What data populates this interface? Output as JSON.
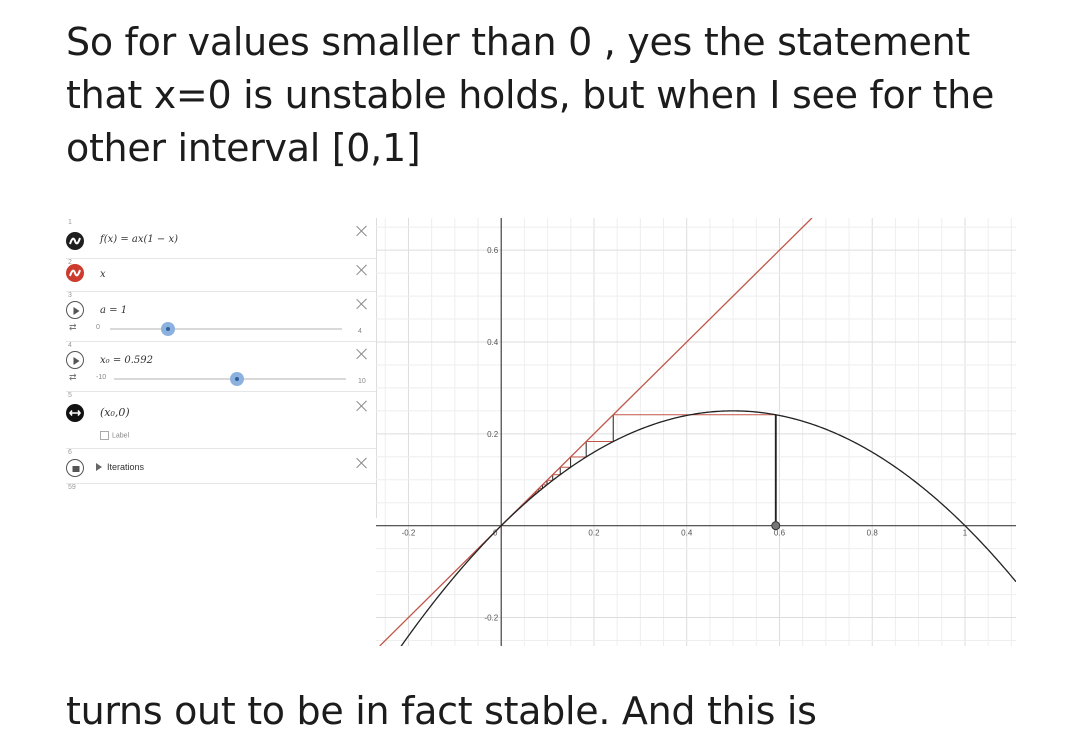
{
  "text": {
    "top": "So for values smaller than 0 , yes the statement that x=0 is unstable holds, but when I see for the other interval [0,1]",
    "bottom": "turns out to be in fact stable. And this is"
  },
  "algebra": {
    "rows": [
      {
        "num": "1",
        "expr": "f(x) = ax(1 − x)"
      },
      {
        "num": "2",
        "expr": "x"
      },
      {
        "num": "3",
        "expr": "a = 1",
        "slider": {
          "min": "0",
          "max": "4",
          "value": 1
        }
      },
      {
        "num": "4",
        "expr": "x₀ = 0.592",
        "slider": {
          "min": "-10",
          "max": "10",
          "value": 0.592
        }
      },
      {
        "num": "5",
        "expr": "(x₀,0)",
        "label_checkbox": "Label"
      },
      {
        "num": "6",
        "toggle": "Iterations"
      },
      {
        "num": "59"
      }
    ]
  },
  "graph": {
    "x_ticks": [
      "-0.2",
      "0",
      "0.2",
      "0.4",
      "0.6",
      "0.8",
      "1"
    ],
    "y_ticks": [
      "0.6",
      "0.4",
      "0.2",
      "-0.2"
    ],
    "x_range": [
      -0.27,
      1.11
    ],
    "y_range": [
      -0.262,
      0.67
    ],
    "colors": {
      "curve": "#222222",
      "line": "#c0574a",
      "grid_minor": "#eeeeee",
      "grid_major": "#dddddd",
      "axis": "#444444"
    }
  }
}
